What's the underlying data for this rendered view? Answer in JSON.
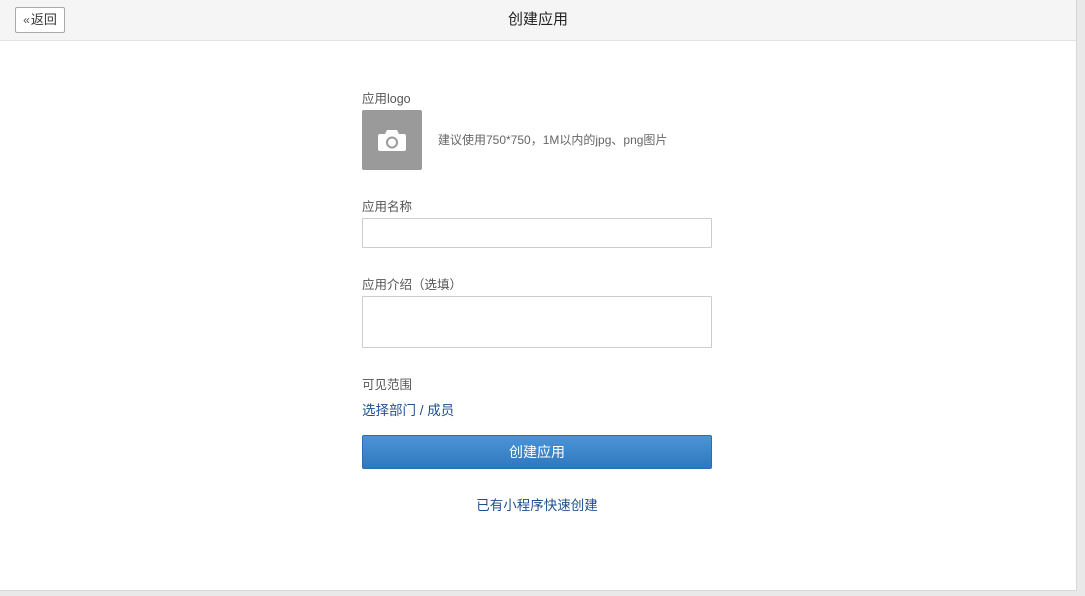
{
  "header": {
    "back_label": "返回",
    "title": "创建应用"
  },
  "form": {
    "logo_label": "应用logo",
    "logo_hint": "建议使用750*750，1M以内的jpg、png图片",
    "logo_icon": "camera-icon",
    "name_label": "应用名称",
    "name_value": "",
    "intro_label": "应用介绍（选填）",
    "intro_value": "",
    "visibility_label": "可见范围",
    "visibility_link": "选择部门 / 成员",
    "submit_label": "创建应用",
    "quick_create_link": "已有小程序快速创建"
  },
  "colors": {
    "primary": "#3a86cc",
    "link": "#1f4f8f",
    "header_bg": "#f5f5f5",
    "logo_placeholder": "#9a9a9a"
  }
}
